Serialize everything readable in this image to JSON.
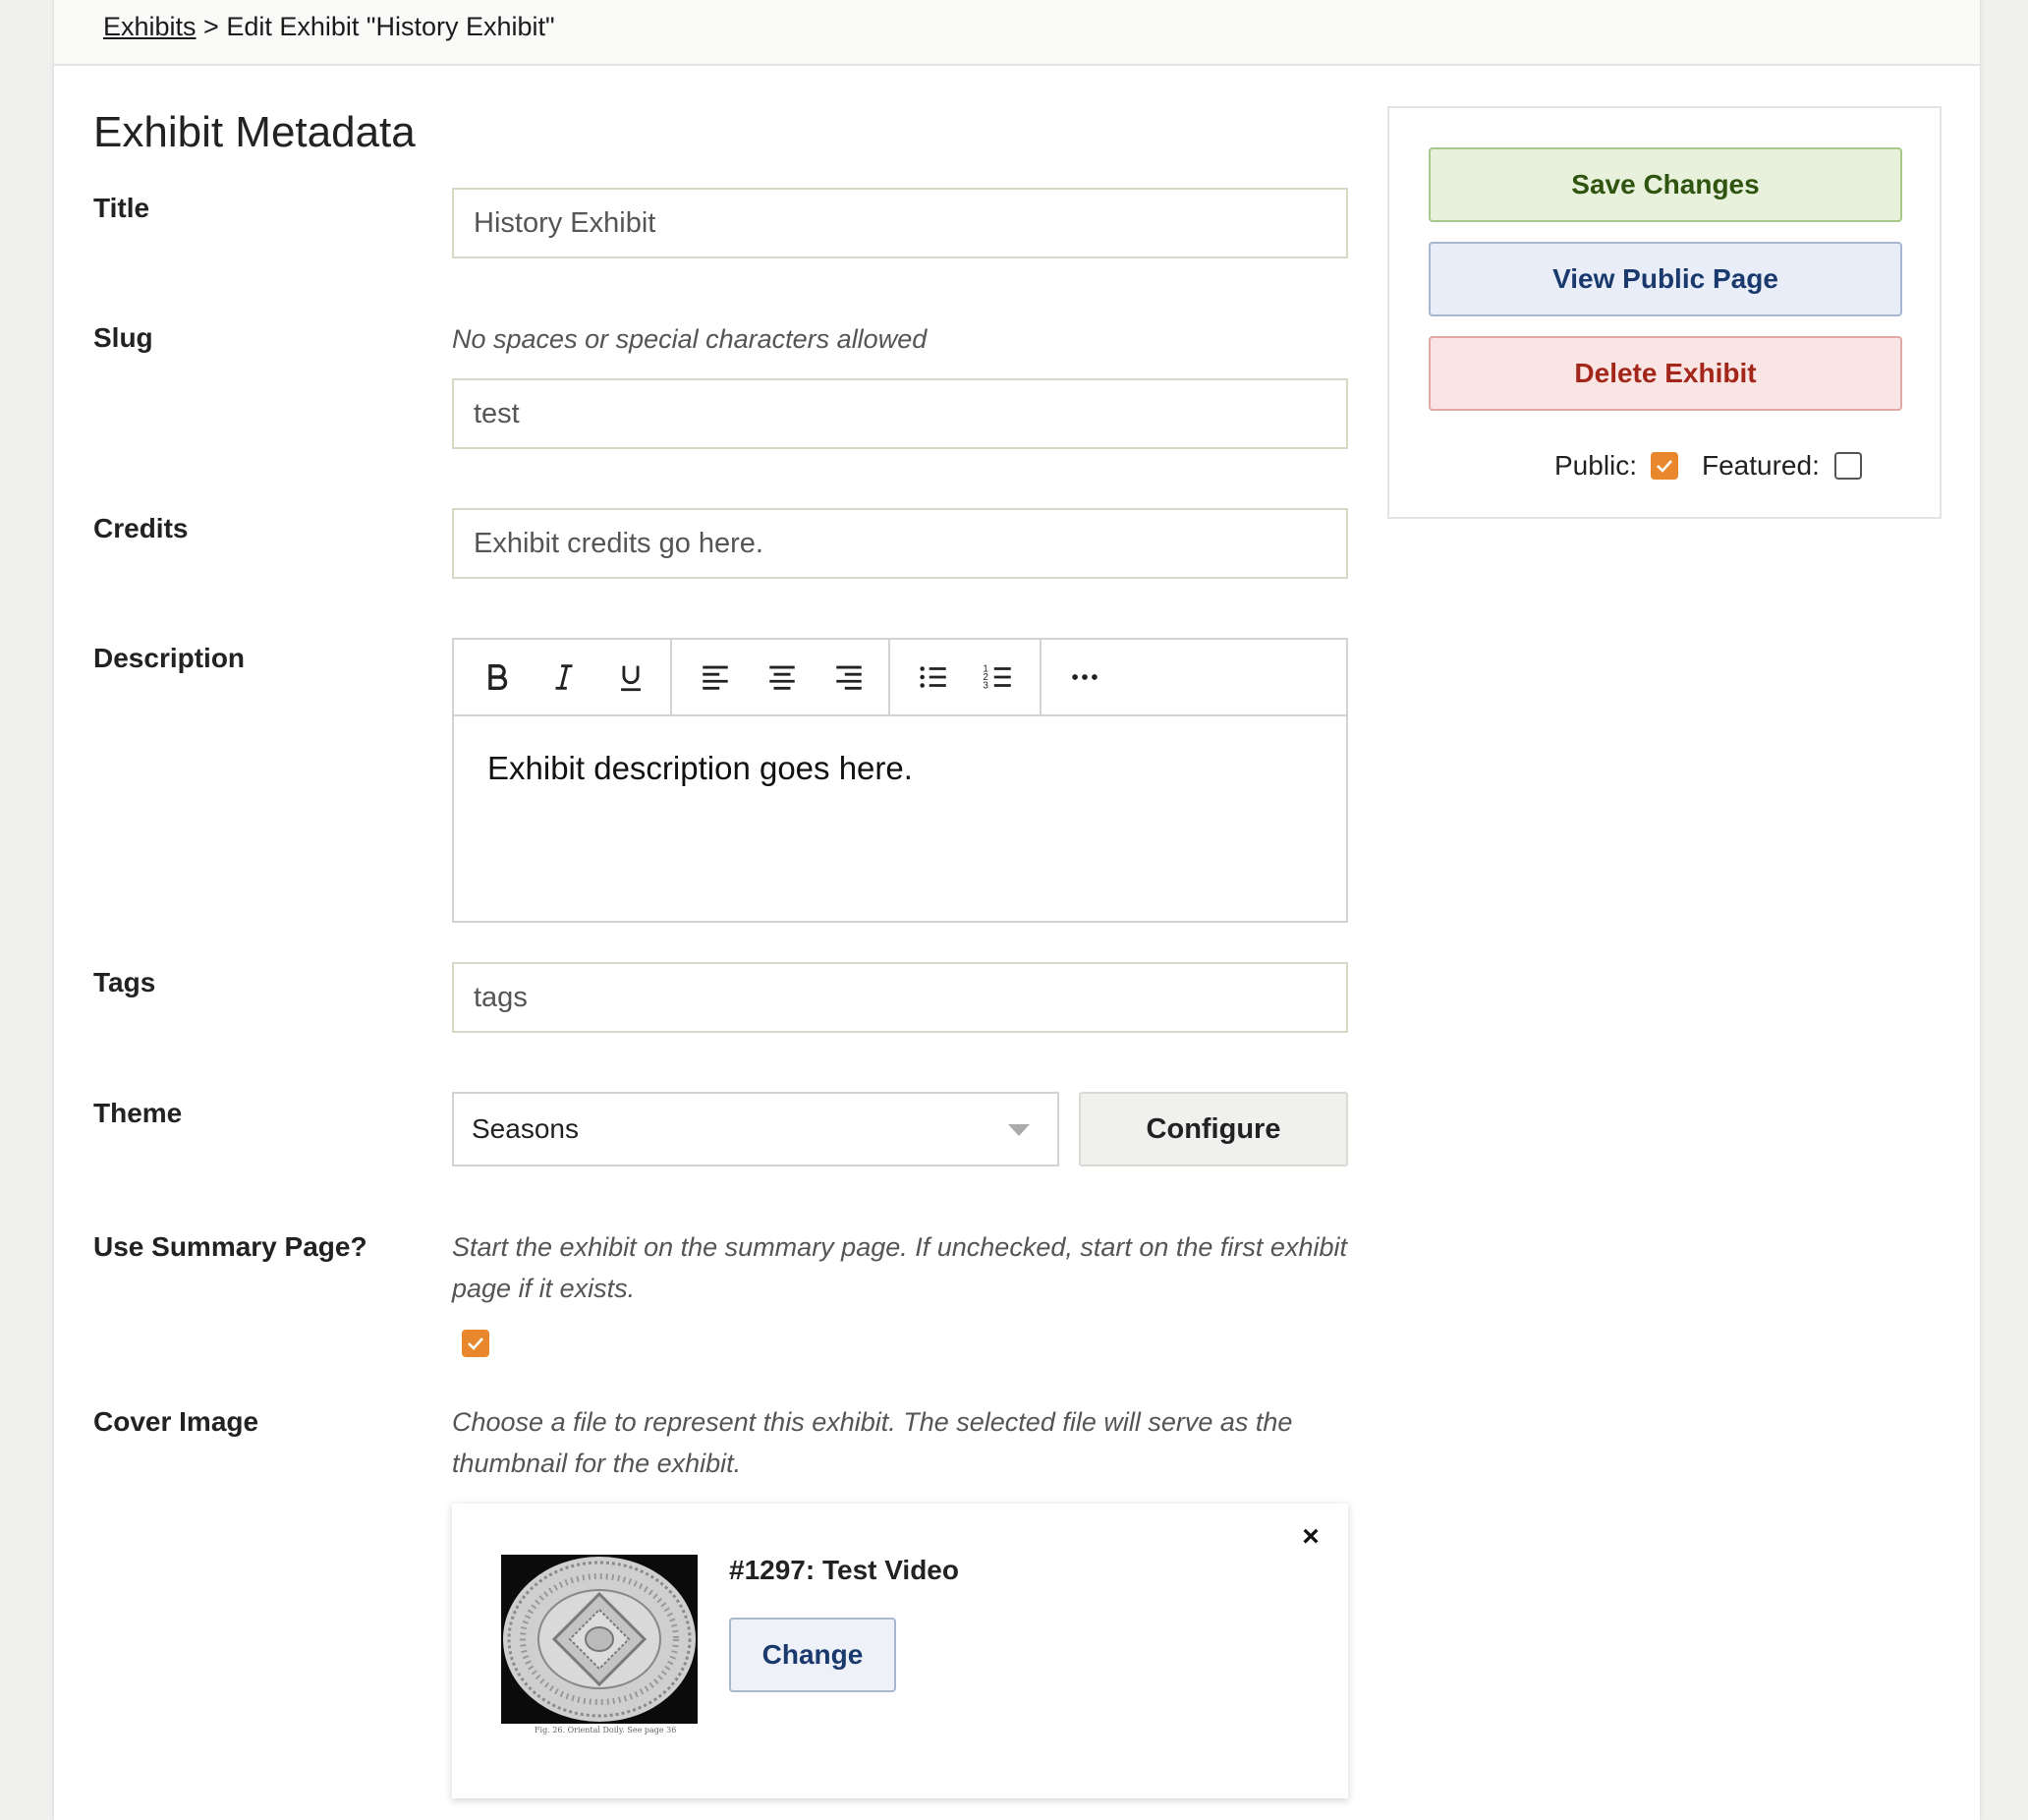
{
  "breadcrumb": {
    "link": "Exhibits",
    "separator": " > ",
    "current": "Edit Exhibit \"History Exhibit\""
  },
  "section_title": "Exhibit Metadata",
  "fields": {
    "title": {
      "label": "Title",
      "value": "History Exhibit"
    },
    "slug": {
      "label": "Slug",
      "hint": "No spaces or special characters allowed",
      "value": "test"
    },
    "credits": {
      "label": "Credits",
      "value": "Exhibit credits go here."
    },
    "description": {
      "label": "Description",
      "value": "Exhibit description goes here."
    },
    "tags": {
      "label": "Tags",
      "value": "tags"
    },
    "theme": {
      "label": "Theme",
      "value": "Seasons",
      "configure_label": "Configure"
    },
    "summary": {
      "label": "Use Summary Page?",
      "hint": "Start the exhibit on the summary page. If unchecked, start on the first exhibit page if it exists.",
      "checked": true
    },
    "cover": {
      "label": "Cover Image",
      "hint": "Choose a file to represent this exhibit. The selected file will serve as the thumbnail for the exhibit.",
      "file_title": "#1297: Test Video",
      "change_label": "Change",
      "thumb_caption": "Fig. 26.  Oriental Doily.  See page 36",
      "close": "×"
    }
  },
  "editor_toolbar": [
    "bold-icon",
    "italic-icon",
    "underline-icon",
    "align-left-icon",
    "align-center-icon",
    "align-right-icon",
    "bullet-list-icon",
    "numbered-list-icon",
    "more-icon"
  ],
  "sidebar": {
    "save_label": "Save Changes",
    "view_label": "View Public Page",
    "delete_label": "Delete Exhibit",
    "public_label": "Public:",
    "public_checked": true,
    "featured_label": "Featured:",
    "featured_checked": false
  },
  "colors": {
    "accent_orange": "#e8872b",
    "save_green": "#2f5410",
    "view_blue": "#1a3a6e",
    "delete_red": "#a3261a"
  }
}
